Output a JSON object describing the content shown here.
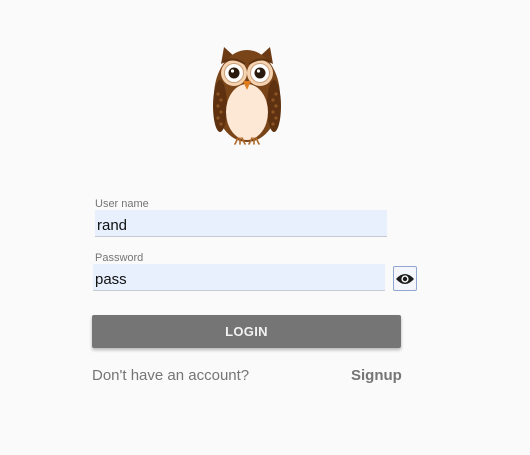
{
  "logo": {
    "icon": "owl-logo-icon",
    "colors": {
      "body": "#7a4419",
      "belly": "#fde8d6",
      "eye_ring": "#f5d2b0"
    }
  },
  "form": {
    "username": {
      "label": "User name",
      "value": "rand"
    },
    "password": {
      "label": "Password",
      "value": "pass",
      "toggle_icon": "eye-icon"
    },
    "login_label": "LOGIN"
  },
  "footer": {
    "prompt": "Don't have an account?",
    "signup_label": "Signup"
  },
  "colors": {
    "background": "#fafafa",
    "input_fill": "#e8f0fe",
    "button": "#757575",
    "muted_text": "#757575"
  }
}
